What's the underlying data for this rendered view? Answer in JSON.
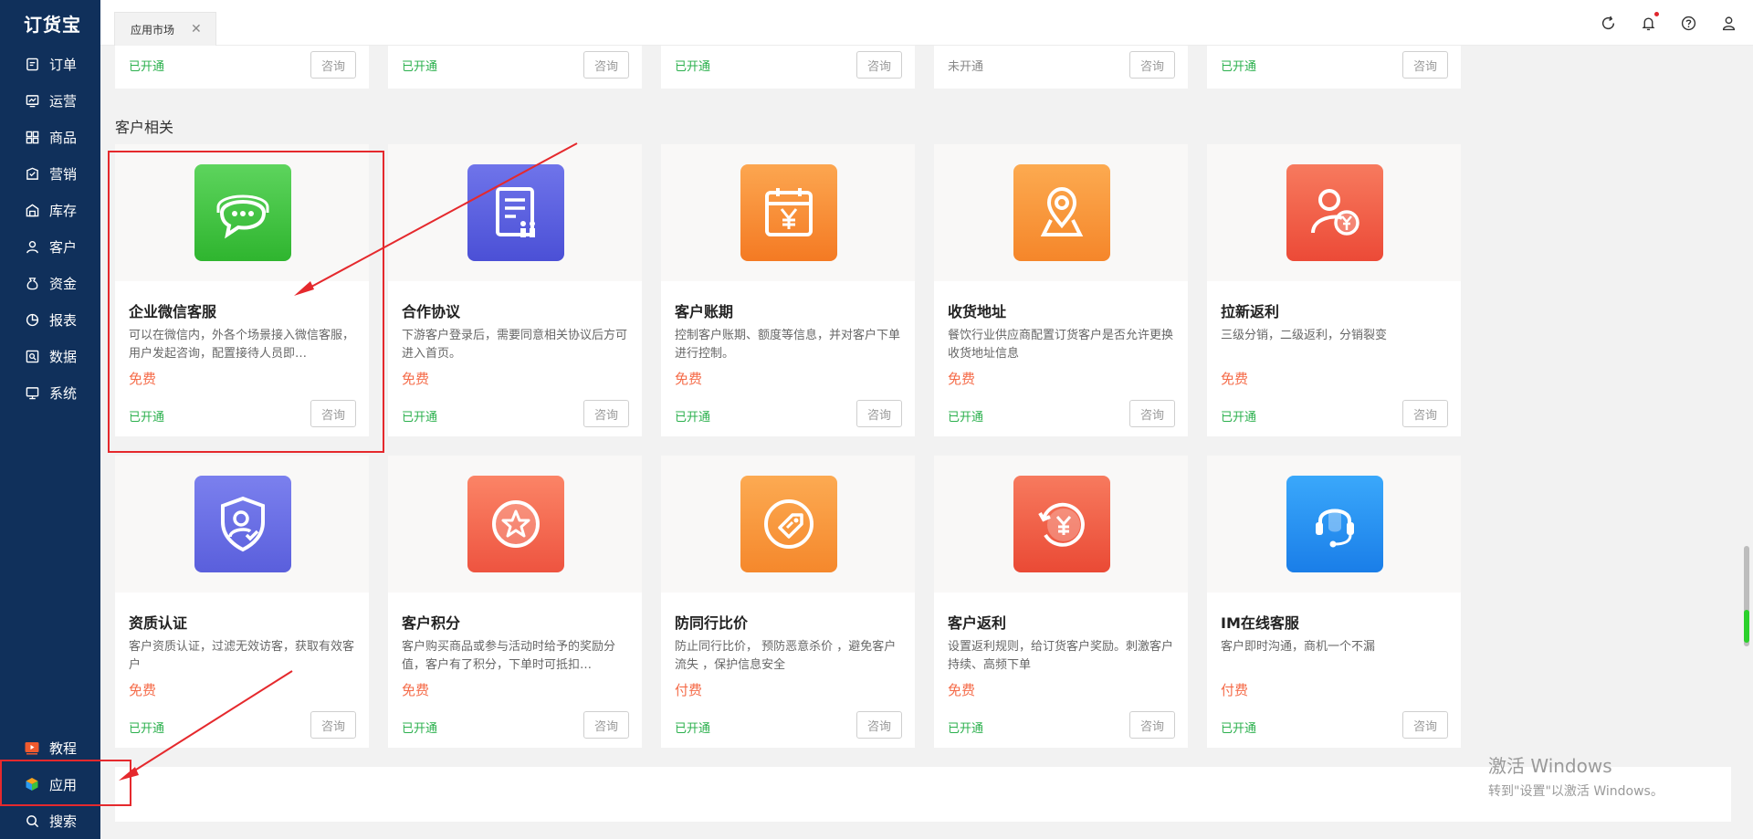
{
  "sidebar": {
    "logo": "订货宝",
    "items": [
      {
        "label": "订单",
        "icon": "order-icon"
      },
      {
        "label": "运营",
        "icon": "operation-icon"
      },
      {
        "label": "商品",
        "icon": "goods-icon"
      },
      {
        "label": "营销",
        "icon": "marketing-icon"
      },
      {
        "label": "库存",
        "icon": "inventory-icon"
      },
      {
        "label": "客户",
        "icon": "customer-icon"
      },
      {
        "label": "资金",
        "icon": "funds-icon"
      },
      {
        "label": "报表",
        "icon": "report-icon"
      },
      {
        "label": "数据",
        "icon": "data-icon"
      },
      {
        "label": "系统",
        "icon": "system-icon"
      }
    ],
    "bottom_items": [
      {
        "label": "教程",
        "icon": "tutorial-icon"
      },
      {
        "label": "应用",
        "icon": "apps-icon"
      },
      {
        "label": "搜索",
        "icon": "search-icon"
      }
    ]
  },
  "topbar": {
    "tab_label": "应用市场",
    "tab_close": "✕"
  },
  "top_strip": [
    {
      "status": "已开通",
      "button": "咨询"
    },
    {
      "status": "已开通",
      "button": "咨询"
    },
    {
      "status": "已开通",
      "button": "咨询"
    },
    {
      "status": "未开通",
      "button": "咨询"
    },
    {
      "status": "已开通",
      "button": "咨询"
    }
  ],
  "section_title": "客户相关",
  "cards": [
    {
      "name": "企业微信客服",
      "desc": "可以在微信内，外各个场景接入微信客服，用户发起咨询，配置接待人员即…",
      "price": "免费",
      "status": "已开通",
      "button": "咨询",
      "icon": "wechat-service-icon",
      "color": "#3cc23c"
    },
    {
      "name": "合作协议",
      "desc": "下游客户登录后，需要同意相关协议后方可进入首页。",
      "price": "免费",
      "status": "已开通",
      "button": "咨询",
      "icon": "agreement-icon",
      "color": "#5b5fe0"
    },
    {
      "name": "客户账期",
      "desc": "控制客户账期、额度等信息，并对客户下单进行控制。",
      "price": "免费",
      "status": "已开通",
      "button": "咨询",
      "icon": "account-period-icon",
      "color": "#f78a32"
    },
    {
      "name": "收货地址",
      "desc": "餐饮行业供应商配置订货客户是否允许更换收货地址信息",
      "price": "免费",
      "status": "已开通",
      "button": "咨询",
      "icon": "location-icon",
      "color": "#f7962f"
    },
    {
      "name": "拉新返利",
      "desc": "三级分销，二级返利，分销裂变",
      "price": "免费",
      "status": "已开通",
      "button": "咨询",
      "icon": "referral-rebate-icon",
      "color": "#f05a45"
    },
    {
      "name": "资质认证",
      "desc": "客户资质认证，过滤无效访客，获取有效客户",
      "price": "免费",
      "status": "已开通",
      "button": "咨询",
      "icon": "certification-icon",
      "color": "#6a6fe6"
    },
    {
      "name": "客户积分",
      "desc": "客户购买商品或参与活动时给予的奖励分值，客户有了积分，下单时可抵扣…",
      "price": "免费",
      "status": "已开通",
      "button": "咨询",
      "icon": "points-star-icon",
      "color": "#f36a4f"
    },
    {
      "name": "防同行比价",
      "desc": "防止同行比价， 预防恶意杀价 ，避免客户流失 ，保护信息安全",
      "price": "付费",
      "status": "已开通",
      "button": "咨询",
      "icon": "price-tag-icon",
      "color": "#f7952f"
    },
    {
      "name": "客户返利",
      "desc": "设置返利规则，给订货客户奖励。刺激客户持续、高频下单",
      "price": "免费",
      "status": "已开通",
      "button": "咨询",
      "icon": "rebate-icon",
      "color": "#f0553f"
    },
    {
      "name": "IM在线客服",
      "desc": "客户即时沟通，商机一个不漏",
      "price": "付费",
      "status": "已开通",
      "button": "咨询",
      "icon": "headset-icon",
      "color": "#1f8ef1"
    }
  ],
  "watermark": {
    "line1": "激活 Windows",
    "line2": "转到\"设置\"以激活 Windows。"
  }
}
